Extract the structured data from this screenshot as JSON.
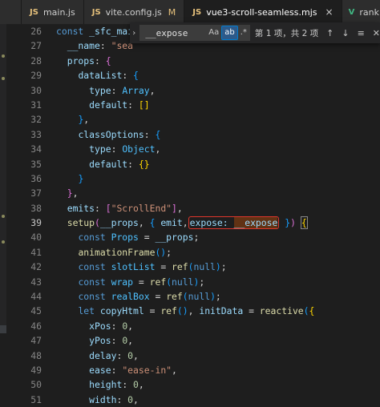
{
  "tabs": [
    {
      "badge": "",
      "label": ""
    },
    {
      "badge": "JS",
      "label": "main.js"
    },
    {
      "badge": "JS",
      "label": "vite.config.js",
      "modified": "M"
    },
    {
      "badge": "JS",
      "label": "vue3-scroll-seamless.mjs",
      "close": "×"
    },
    {
      "badge": "V",
      "label": "rank.vue"
    }
  ],
  "find": {
    "query": "__expose",
    "opt_case": "Aa",
    "opt_word": "ab",
    "opt_regex": ".*",
    "count": "第 1 项，共 2 项",
    "prev_icon": "arrow-up-icon",
    "next_icon": "arrow-down-icon",
    "selection_icon": "find-in-selection-icon",
    "close_icon": "close-icon"
  },
  "lines": [
    {
      "n": "26",
      "t": [
        [
          "kw",
          "const "
        ],
        [
          "var",
          "_sfc_main"
        ],
        [
          "code",
          " = {"
        ]
      ]
    },
    {
      "n": "27",
      "t": [
        [
          "code",
          "  "
        ],
        [
          "var",
          "__name"
        ],
        [
          "code",
          ": "
        ],
        [
          "str",
          "\"sea"
        ]
      ]
    },
    {
      "n": "28",
      "t": [
        [
          "code",
          "  "
        ],
        [
          "var",
          "props"
        ],
        [
          "code",
          ": "
        ],
        [
          "br2",
          "{"
        ]
      ]
    },
    {
      "n": "29",
      "t": [
        [
          "code",
          "    "
        ],
        [
          "var",
          "dataList"
        ],
        [
          "code",
          ": "
        ],
        [
          "br3",
          "{"
        ]
      ]
    },
    {
      "n": "30",
      "t": [
        [
          "code",
          "      "
        ],
        [
          "var",
          "type"
        ],
        [
          "code",
          ": "
        ],
        [
          "const",
          "Array"
        ],
        [
          "code",
          ","
        ]
      ]
    },
    {
      "n": "31",
      "t": [
        [
          "code",
          "      "
        ],
        [
          "var",
          "default"
        ],
        [
          "code",
          ": "
        ],
        [
          "br1",
          "[]"
        ]
      ]
    },
    {
      "n": "32",
      "t": [
        [
          "code",
          "    "
        ],
        [
          "br3",
          "}"
        ],
        [
          "code",
          ","
        ]
      ]
    },
    {
      "n": "33",
      "t": [
        [
          "code",
          "    "
        ],
        [
          "var",
          "classOptions"
        ],
        [
          "code",
          ": "
        ],
        [
          "br3",
          "{"
        ]
      ]
    },
    {
      "n": "34",
      "t": [
        [
          "code",
          "      "
        ],
        [
          "var",
          "type"
        ],
        [
          "code",
          ": "
        ],
        [
          "const",
          "Object"
        ],
        [
          "code",
          ","
        ]
      ]
    },
    {
      "n": "35",
      "t": [
        [
          "code",
          "      "
        ],
        [
          "var",
          "default"
        ],
        [
          "code",
          ": "
        ],
        [
          "br1",
          "{}"
        ]
      ]
    },
    {
      "n": "36",
      "t": [
        [
          "code",
          "    "
        ],
        [
          "br3",
          "}"
        ]
      ]
    },
    {
      "n": "37",
      "t": [
        [
          "code",
          "  "
        ],
        [
          "br2",
          "}"
        ],
        [
          "code",
          ","
        ]
      ]
    },
    {
      "n": "38",
      "t": [
        [
          "code",
          "  "
        ],
        [
          "var",
          "emits"
        ],
        [
          "code",
          ": "
        ],
        [
          "br2",
          "["
        ],
        [
          "str",
          "\"ScrollEnd\""
        ],
        [
          "br2",
          "]"
        ],
        [
          "code",
          ","
        ]
      ]
    },
    {
      "n": "39",
      "cur": true,
      "t": [
        [
          "code",
          "  "
        ],
        [
          "fn",
          "setup"
        ],
        [
          "br2",
          "("
        ],
        [
          "var",
          "__props"
        ],
        [
          "code",
          ", "
        ],
        [
          "br3",
          "{ "
        ],
        [
          "var",
          "emit"
        ],
        [
          "code",
          ","
        ],
        [
          "box",
          "expose: __expose"
        ],
        [
          "code",
          " "
        ],
        [
          "br3",
          "}"
        ],
        [
          "br2",
          ")"
        ],
        [
          "code",
          " "
        ],
        [
          "bb",
          "{"
        ]
      ]
    },
    {
      "n": "40",
      "t": [
        [
          "code",
          "    "
        ],
        [
          "kw",
          "const "
        ],
        [
          "const",
          "Props"
        ],
        [
          "code",
          " = "
        ],
        [
          "var",
          "__props"
        ],
        [
          "code",
          ";"
        ]
      ]
    },
    {
      "n": "41",
      "t": [
        [
          "code",
          "    "
        ],
        [
          "fn",
          "animationFrame"
        ],
        [
          "br3",
          "()"
        ],
        [
          "code",
          ";"
        ]
      ]
    },
    {
      "n": "42",
      "t": [
        [
          "code",
          "    "
        ],
        [
          "kw",
          "const "
        ],
        [
          "const",
          "slotList"
        ],
        [
          "code",
          " = "
        ],
        [
          "fn",
          "ref"
        ],
        [
          "br3",
          "("
        ],
        [
          "kw",
          "null"
        ],
        [
          "br3",
          ")"
        ],
        [
          "code",
          ";"
        ]
      ]
    },
    {
      "n": "43",
      "t": [
        [
          "code",
          "    "
        ],
        [
          "kw",
          "const "
        ],
        [
          "const",
          "wrap"
        ],
        [
          "code",
          " = "
        ],
        [
          "fn",
          "ref"
        ],
        [
          "br3",
          "("
        ],
        [
          "kw",
          "null"
        ],
        [
          "br3",
          ")"
        ],
        [
          "code",
          ";"
        ]
      ]
    },
    {
      "n": "44",
      "t": [
        [
          "code",
          "    "
        ],
        [
          "kw",
          "const "
        ],
        [
          "const",
          "realBox"
        ],
        [
          "code",
          " = "
        ],
        [
          "fn",
          "ref"
        ],
        [
          "br3",
          "("
        ],
        [
          "kw",
          "null"
        ],
        [
          "br3",
          ")"
        ],
        [
          "code",
          ";"
        ]
      ]
    },
    {
      "n": "45",
      "t": [
        [
          "code",
          "    "
        ],
        [
          "kw",
          "let "
        ],
        [
          "var",
          "copyHtml"
        ],
        [
          "code",
          " = "
        ],
        [
          "fn",
          "ref"
        ],
        [
          "br3",
          "()"
        ],
        [
          "code",
          ", "
        ],
        [
          "var",
          "initData"
        ],
        [
          "code",
          " = "
        ],
        [
          "fn",
          "reactive"
        ],
        [
          "br3",
          "("
        ],
        [
          "br1",
          "{"
        ]
      ]
    },
    {
      "n": "46",
      "t": [
        [
          "code",
          "      "
        ],
        [
          "var",
          "xPos"
        ],
        [
          "code",
          ": "
        ],
        [
          "num",
          "0"
        ],
        [
          "code",
          ","
        ]
      ]
    },
    {
      "n": "47",
      "t": [
        [
          "code",
          "      "
        ],
        [
          "var",
          "yPos"
        ],
        [
          "code",
          ": "
        ],
        [
          "num",
          "0"
        ],
        [
          "code",
          ","
        ]
      ]
    },
    {
      "n": "48",
      "t": [
        [
          "code",
          "      "
        ],
        [
          "var",
          "delay"
        ],
        [
          "code",
          ": "
        ],
        [
          "num",
          "0"
        ],
        [
          "code",
          ","
        ]
      ]
    },
    {
      "n": "49",
      "t": [
        [
          "code",
          "      "
        ],
        [
          "var",
          "ease"
        ],
        [
          "code",
          ": "
        ],
        [
          "str",
          "\"ease-in\""
        ],
        [
          "code",
          ","
        ]
      ]
    },
    {
      "n": "50",
      "t": [
        [
          "code",
          "      "
        ],
        [
          "var",
          "height"
        ],
        [
          "code",
          ": "
        ],
        [
          "num",
          "0"
        ],
        [
          "code",
          ","
        ]
      ]
    },
    {
      "n": "51",
      "t": [
        [
          "code",
          "      "
        ],
        [
          "var",
          "width"
        ],
        [
          "code",
          ": "
        ],
        [
          "num",
          "0"
        ],
        [
          "code",
          ","
        ]
      ]
    }
  ]
}
